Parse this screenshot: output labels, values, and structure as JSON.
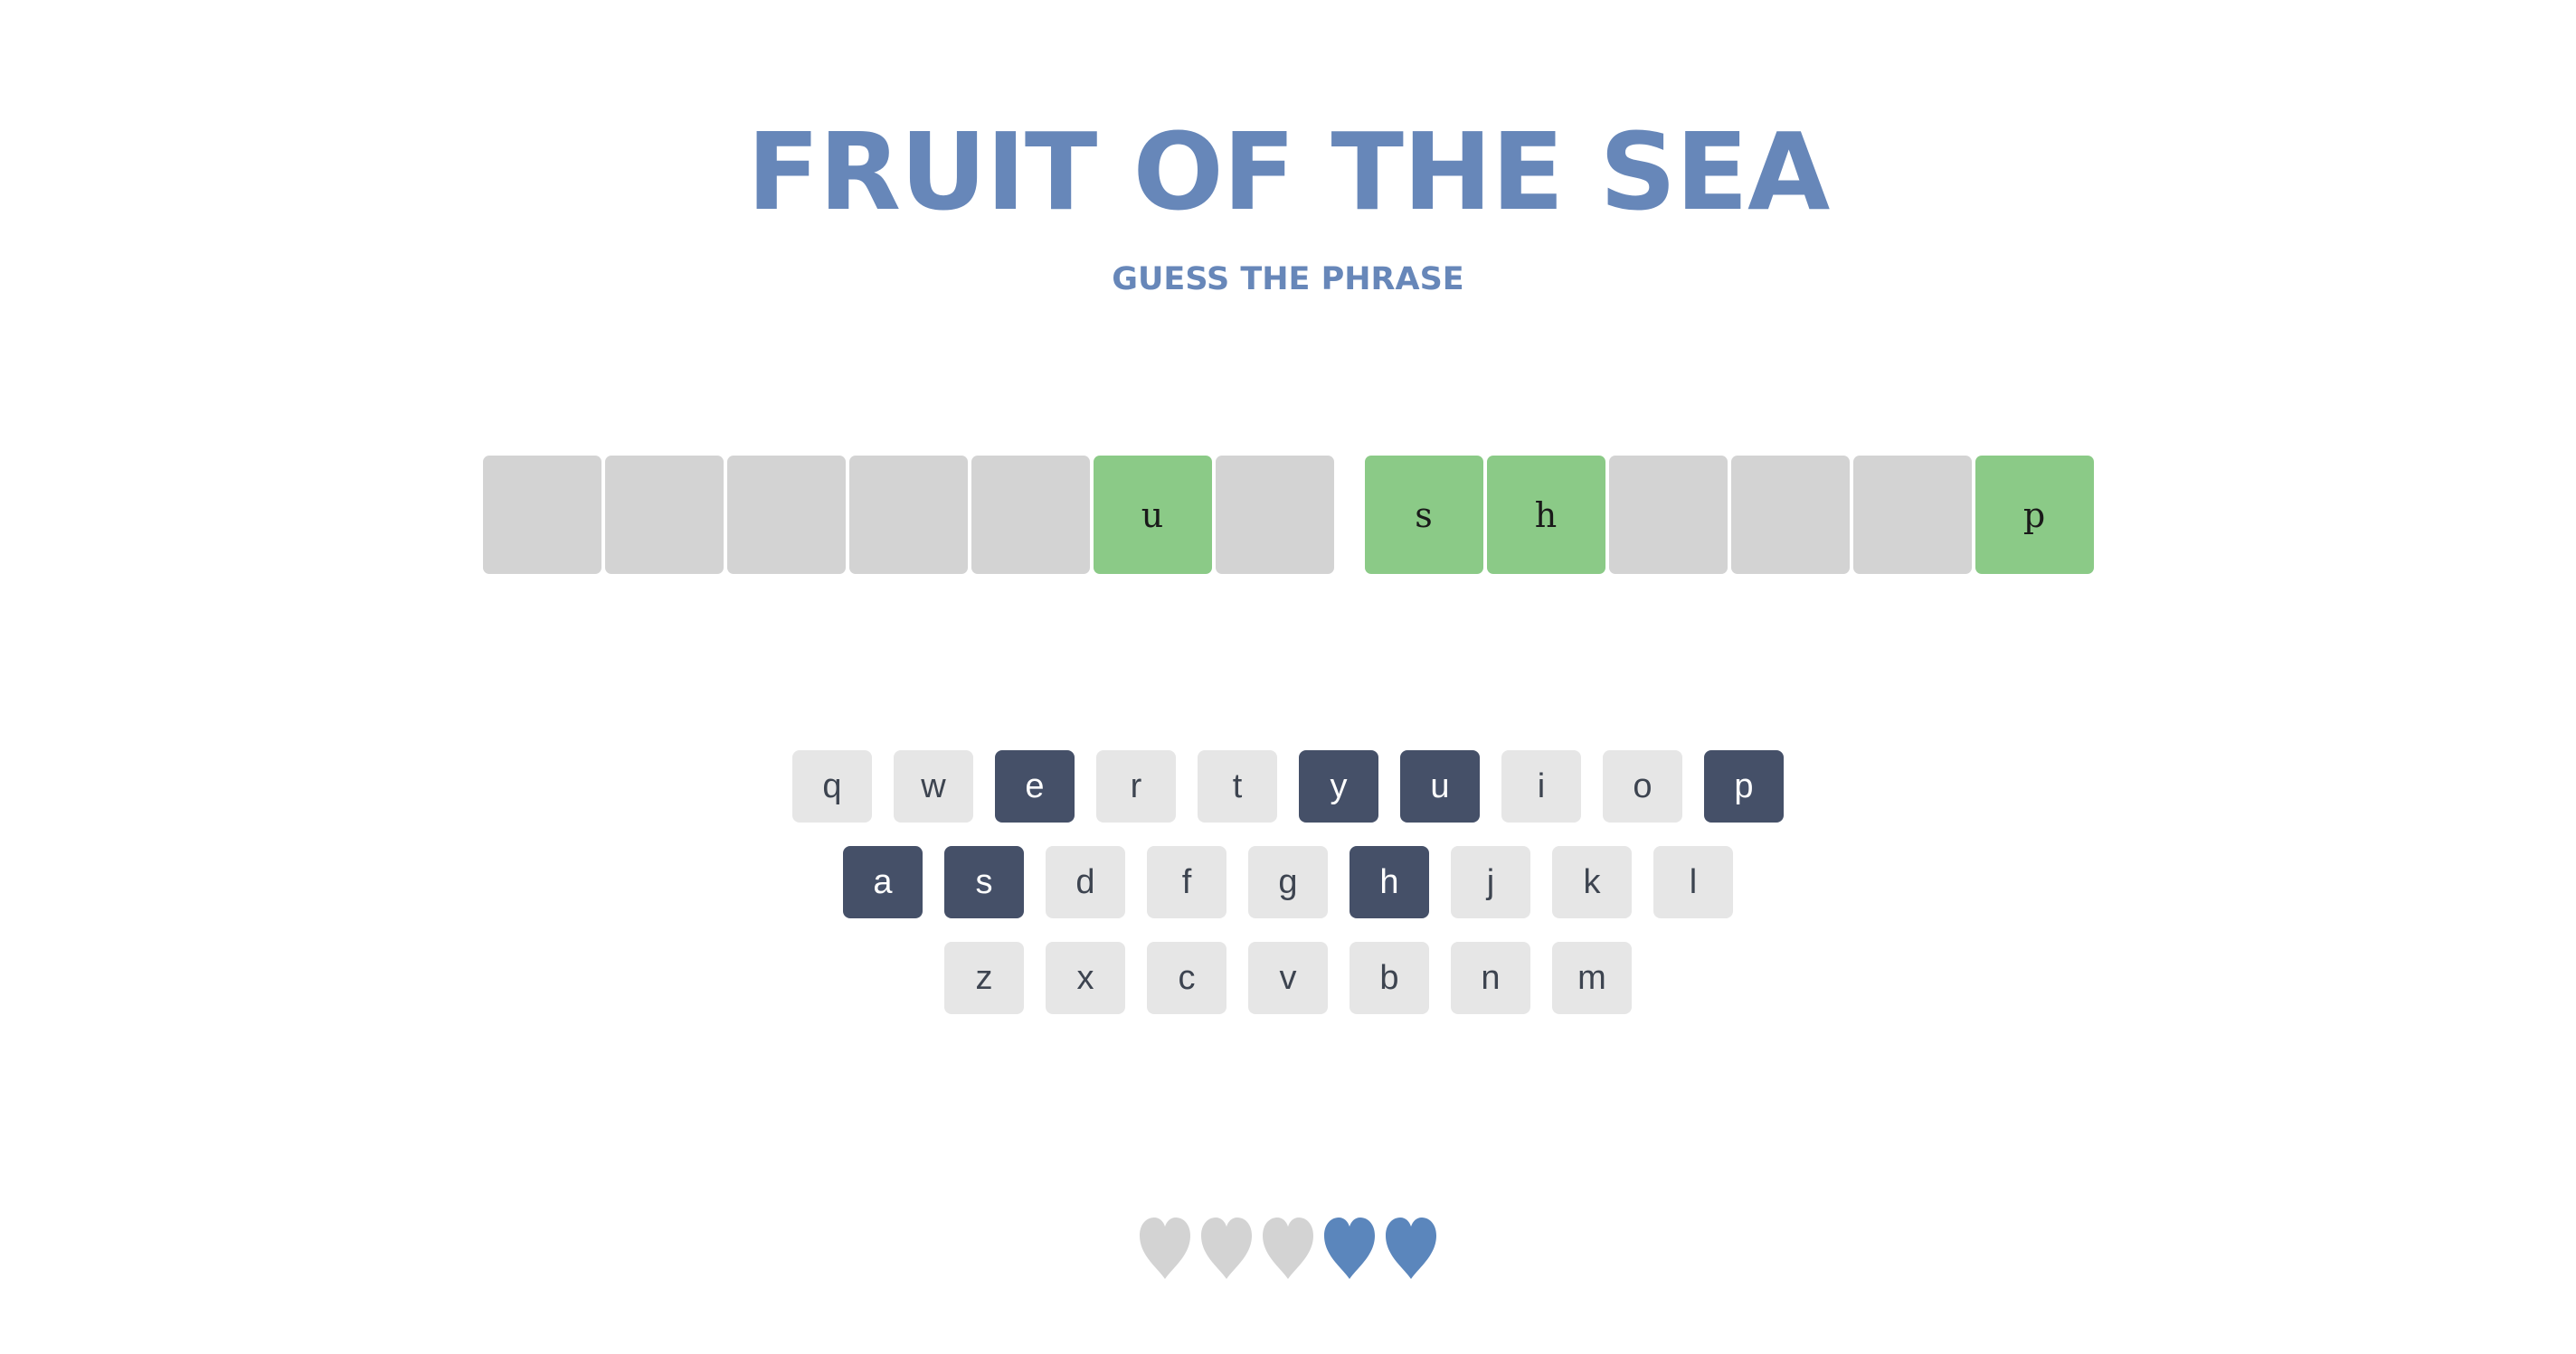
{
  "header": {
    "title": "FRUIT OF THE SEA",
    "subtitle": "GUESS THE PHRASE"
  },
  "board": {
    "words": [
      [
        "",
        "",
        "",
        "",
        "",
        "u",
        ""
      ],
      [
        "s",
        "h",
        "",
        "",
        "",
        "p"
      ]
    ]
  },
  "keyboard": {
    "rows": [
      [
        "q",
        "w",
        "e",
        "r",
        "t",
        "y",
        "u",
        "i",
        "o",
        "p"
      ],
      [
        "a",
        "s",
        "d",
        "f",
        "g",
        "h",
        "j",
        "k",
        "l"
      ],
      [
        "z",
        "x",
        "c",
        "v",
        "b",
        "n",
        "m"
      ]
    ],
    "used": [
      "e",
      "y",
      "u",
      "p",
      "a",
      "s",
      "h"
    ]
  },
  "lives": {
    "total": 5,
    "remaining": 2,
    "icon": "heart-icon"
  },
  "colors": {
    "accent": "#6787b9",
    "tile_hidden": "#d3d3d3",
    "tile_revealed": "#8bca87",
    "key_default": "#e6e6e6",
    "key_used": "#455068",
    "heart_lost": "#d3d3d3",
    "heart_remaining": "#5b86bc"
  }
}
